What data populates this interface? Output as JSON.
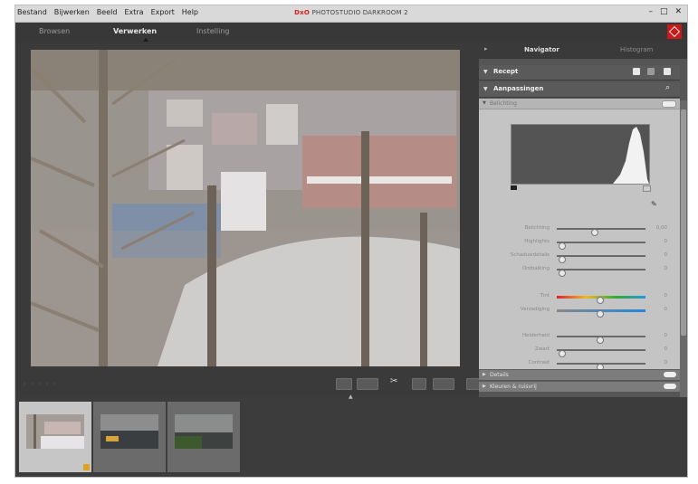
{
  "window": {
    "title_brand": "DxO",
    "title_rest": "PHOTOSTUDIO DARKROOM 2",
    "controls": [
      "–",
      "□",
      "✕"
    ]
  },
  "menu": [
    "Bestand",
    "Bijwerken",
    "Beeld",
    "Extra",
    "Export",
    "Help"
  ],
  "modes": [
    {
      "label": "Browsen",
      "active": false
    },
    {
      "label": "Verwerken",
      "active": true
    },
    {
      "label": "Instelling",
      "active": false
    }
  ],
  "panel": {
    "tabs": [
      {
        "label": "Navigator",
        "active": true
      },
      {
        "label": "Histogram",
        "active": false
      }
    ],
    "recept_header": "Recept",
    "adjust_header": "Aanpassingen",
    "subsection": "Belichting",
    "sliders": [
      {
        "label": "Belichting",
        "value": "0,00",
        "pos": 0.42
      },
      {
        "label": "Highlights",
        "value": "0",
        "pos": 0.05
      },
      {
        "label": "Schaduwdetails",
        "value": "0",
        "pos": 0.05
      },
      {
        "label": "Ontbalking",
        "value": "0",
        "pos": 0.05
      },
      {
        "label": "Tint",
        "value": "0",
        "pos": 0.48
      },
      {
        "label": "Verzadiging",
        "value": "0",
        "pos": 0.48
      },
      {
        "label": "Helderheid",
        "value": "0",
        "pos": 0.48
      },
      {
        "label": "Zwart",
        "value": "0",
        "pos": 0.05
      },
      {
        "label": "Contrast",
        "value": "0",
        "pos": 0.48
      }
    ],
    "collapsed": [
      "Details",
      "Kleuren & ruisvrij"
    ]
  },
  "colors": {
    "brand_red": "#c81b1b",
    "app_bg": "#4a4a4a",
    "panel_content": "#c4c4c4"
  },
  "icons": {
    "recept": [
      "save-icon",
      "reset-icon",
      "menu-icon"
    ],
    "adjust": [
      "search-icon"
    ]
  }
}
